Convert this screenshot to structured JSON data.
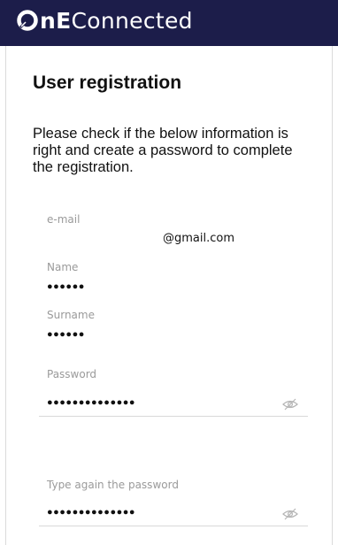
{
  "header": {
    "brand_bold_first": "n",
    "brand_bold_second": "E",
    "brand_rest": "Connected",
    "logo_icon": "brand-logo-mark",
    "bg_color": "#1c1d4a"
  },
  "form": {
    "title": "User registration",
    "intro": "Please check if the below information is right and create a password to complete the registration.",
    "email": {
      "label": "e-mail",
      "value": "@gmail.com"
    },
    "name": {
      "label": "Name",
      "value": "●●●●●●"
    },
    "surname": {
      "label": "Surname",
      "value": "●●●●●●"
    },
    "password": {
      "label": "Password",
      "value": "●●●●●●●●●●●●●●",
      "toggle_icon": "eye-slash-icon"
    },
    "password_confirm": {
      "label": "Type again the password",
      "value": "●●●●●●●●●●●●●●",
      "toggle_icon": "eye-slash-icon"
    }
  }
}
